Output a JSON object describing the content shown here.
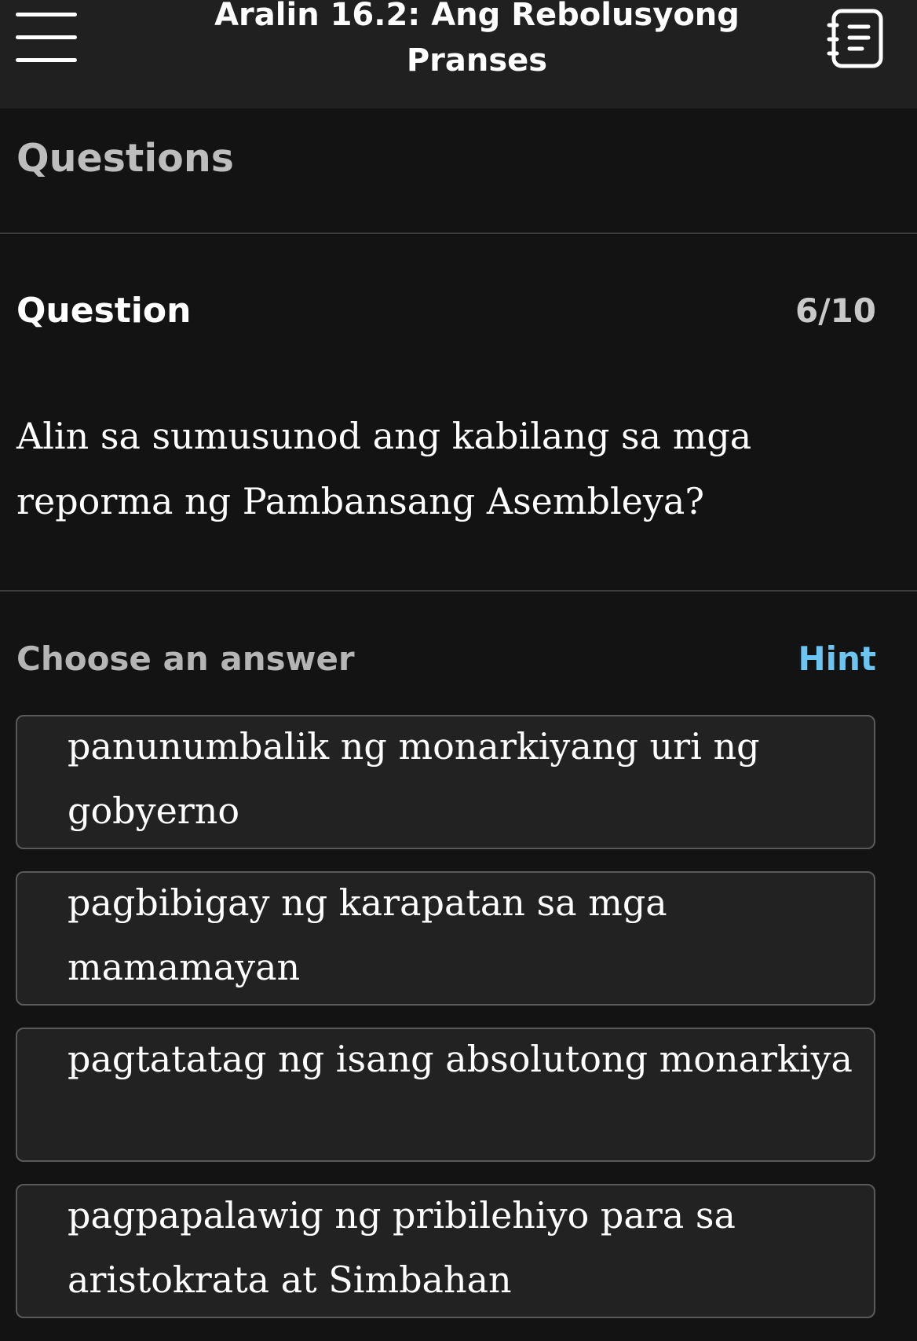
{
  "header": {
    "title": "Aralin 16.2: Ang Rebolusyong Pranses",
    "menu_icon": "hamburger-menu-icon",
    "notes_icon": "notes-icon"
  },
  "section": {
    "title": "Questions"
  },
  "question": {
    "label": "Question",
    "counter": "6/10",
    "text": "Alin sa sumusunod ang kabilang sa mga reporma ng Pambansang Asembleya?"
  },
  "answers": {
    "prompt": "Choose an answer",
    "hint_label": "Hint",
    "options": [
      "panunumbalik ng monarkiyang uri ng gobyerno",
      "pagbibigay ng karapatan sa mga mamamayan",
      "pagtatatag ng isang absolutong monarkiya",
      "pagpapalawig ng pribilehiyo para sa aristokrata at Simbahan"
    ]
  },
  "colors": {
    "background": "#131313",
    "header_background": "#202020",
    "option_background": "#222222",
    "option_border": "#5a5a5a",
    "hint_accent": "#6cc4f1"
  }
}
